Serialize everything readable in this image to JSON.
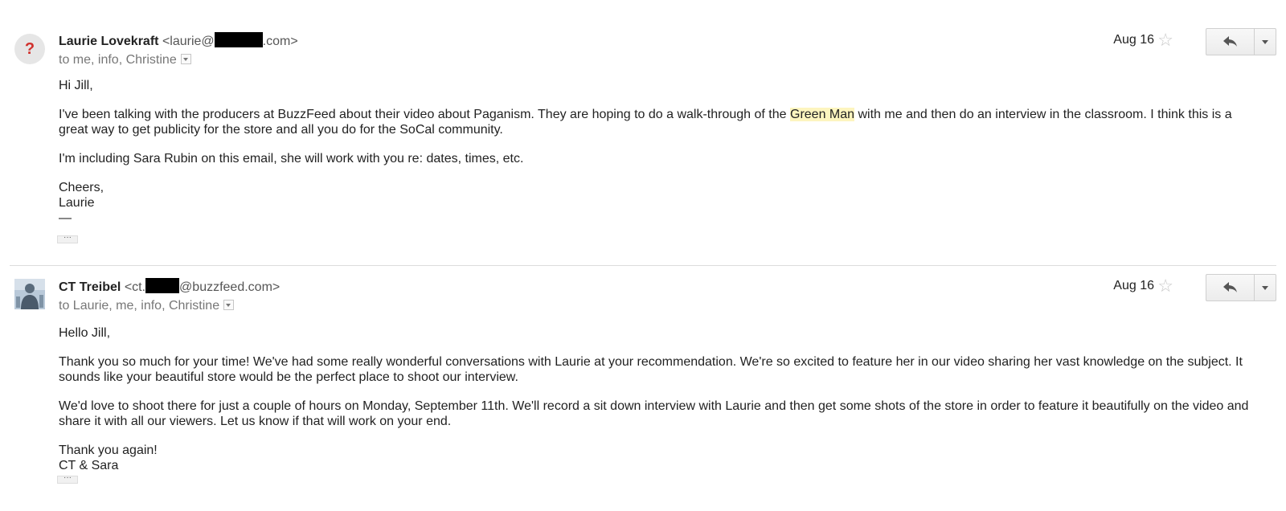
{
  "messages": [
    {
      "sender_name": "Laurie Lovekraft",
      "sender_email_prefix": "<laurie@",
      "sender_email_suffix": ".com>",
      "recipients": "to me, info, Christine",
      "date": "Aug 16",
      "avatar_glyph": "?",
      "greeting": "Hi Jill,",
      "para1_before": "I've been talking with the producers at BuzzFeed about their video about Paganism. They are hoping to do a walk-through of the ",
      "para1_highlight": "Green Man",
      "para1_after": " with me and then do an interview in the classroom. I think this is a great way to get publicity for the store and all you do for the SoCal community.",
      "para2": "I'm including Sara Rubin on this email, she will work with you re: dates, times, etc.",
      "closing": "Cheers,",
      "signature": "Laurie",
      "signature_dash": "—",
      "trimmed_label": "···"
    },
    {
      "sender_name": "CT Treibel",
      "sender_email_prefix": "<ct.",
      "sender_email_suffix": "@buzzfeed.com>",
      "recipients": "to Laurie, me, info, Christine",
      "date": "Aug 16",
      "greeting": "Hello Jill,",
      "para1": "Thank you so much for your time! We've had some really wonderful conversations with Laurie at your recommendation. We're so excited to feature her in our video sharing her vast knowledge on the subject. It sounds like your beautiful store would be the perfect place to shoot our interview.",
      "para2": "We'd love to shoot there for just a couple of hours on Monday, September 11th. We'll record a sit down interview with Laurie and then get some shots of the store in order to feature it beautifully on the video and share it with all our viewers. Let us know if that will work on your end.",
      "closing": "Thank you again!",
      "signature": "CT & Sara",
      "trimmed_label": "···"
    }
  ],
  "icons": {
    "star": "star-icon",
    "reply": "reply-icon",
    "more": "chevron-down-icon"
  },
  "colors": {
    "highlight": "#fdf5bf",
    "unknown_avatar_mark": "#d0312d"
  }
}
